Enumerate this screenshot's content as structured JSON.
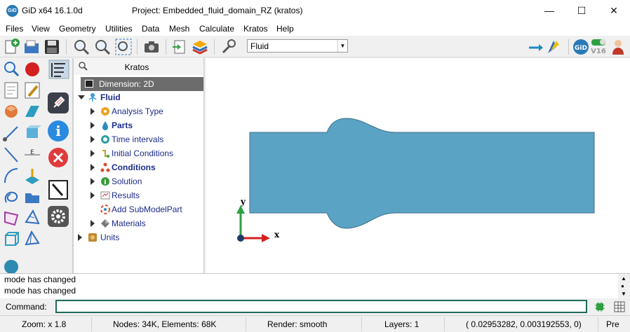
{
  "window": {
    "app_title": "GiD x64 16.1.0d",
    "project_title": "Project: Embedded_fluid_domain_RZ (kratos)",
    "app_icon": "GiD"
  },
  "menu": [
    "Files",
    "View",
    "Geometry",
    "Utilities",
    "Data",
    "Mesh",
    "Calculate",
    "Kratos",
    "Help"
  ],
  "toolbar": {
    "mode_select": "Fluid",
    "version_badge": "V16",
    "gid_badge": "GiD"
  },
  "panel": {
    "title": "Kratos",
    "dimension": "Dimension: 2D",
    "root": "Fluid",
    "items": [
      {
        "label": "Analysis Type",
        "bold": false,
        "icon": "analysis-type-icon"
      },
      {
        "label": "Parts",
        "bold": true,
        "icon": "drop-icon"
      },
      {
        "label": "Time intervals",
        "bold": false,
        "icon": "clock-icon"
      },
      {
        "label": "Initial Conditions",
        "bold": false,
        "icon": "initial-conditions-icon"
      },
      {
        "label": "Conditions",
        "bold": true,
        "icon": "conditions-icon"
      },
      {
        "label": "Solution",
        "bold": false,
        "icon": "info-icon"
      },
      {
        "label": "Results",
        "bold": false,
        "icon": "results-icon"
      },
      {
        "label": "Add SubModelPart",
        "bold": false,
        "icon": "submodelpart-icon"
      },
      {
        "label": "Materials",
        "bold": false,
        "icon": "materials-icon"
      }
    ],
    "units": "Units"
  },
  "viewport": {
    "axis_x": "x",
    "axis_y": "y",
    "shape_color": "#5ba3c5"
  },
  "messages": [
    "mode has changed",
    "mode has changed"
  ],
  "command": {
    "label": "Command:",
    "value": ""
  },
  "status": {
    "zoom": "Zoom: x 1.8",
    "counts": "Nodes: 34K, Elements: 68K",
    "render": "Render: smooth",
    "layers": "Layers: 1",
    "coords": "( 0.02953282,  0.003192553,  0)",
    "mode": "Pre"
  }
}
